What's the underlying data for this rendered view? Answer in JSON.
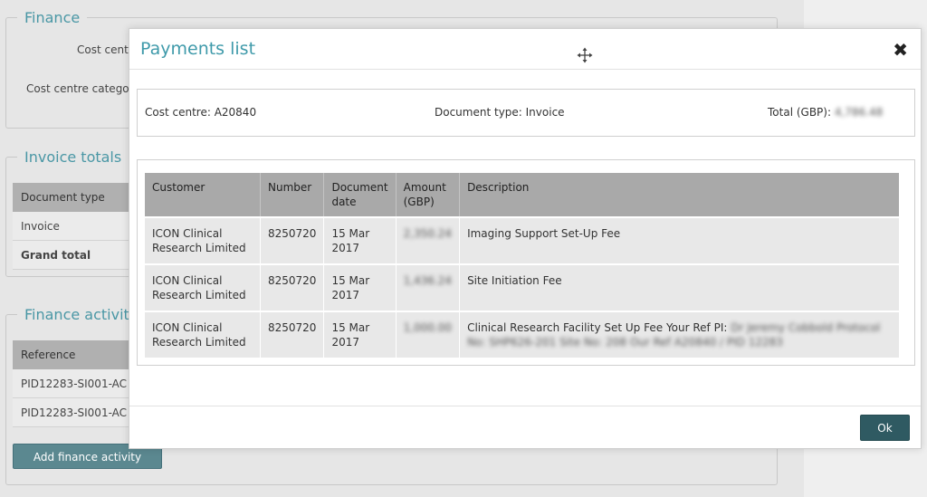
{
  "background": {
    "finance": {
      "legend": "Finance",
      "cost_centre_label": "Cost cent",
      "cost_centre_category_label": "Cost centre catego"
    },
    "invoice_totals": {
      "legend": "Invoice totals",
      "header": "Document type",
      "rows": [
        "Invoice",
        "Grand total"
      ]
    },
    "finance_activities": {
      "legend": "Finance activitie",
      "header": "Reference",
      "rows": [
        "PID12283-SI001-AC",
        "PID12283-SI001-AC"
      ],
      "add_button": "Add finance activity"
    }
  },
  "modal": {
    "title": "Payments list",
    "summary": {
      "cost_centre": "Cost centre: A20840",
      "document_type": "Document type: Invoice",
      "total_label": "Total (GBP):",
      "total_value": "4,786.48"
    },
    "table": {
      "headers": [
        "Customer",
        "Number",
        "Document date",
        "Amount (GBP)",
        "Description"
      ],
      "rows": [
        {
          "customer": "ICON Clinical Research Limited",
          "number": "8250720",
          "date": "15 Mar 2017",
          "amount": "2,350.24",
          "description": "Imaging Support Set-Up Fee",
          "description_blurred": ""
        },
        {
          "customer": "ICON Clinical Research Limited",
          "number": "8250720",
          "date": "15 Mar 2017",
          "amount": "1,436.24",
          "description": "Site Initiation Fee",
          "description_blurred": ""
        },
        {
          "customer": "ICON Clinical Research Limited",
          "number": "8250720",
          "date": "15 Mar 2017",
          "amount": "1,000.00",
          "description": "Clinical Research Facility Set Up Fee Your Ref PI:",
          "description_blurred": "Dr Jeremy Cobbold Protocol No: SHP626-201 Site No: 208 Our Ref A20840 / PID 12283"
        }
      ]
    },
    "ok_label": "Ok",
    "icons": {
      "move": "move-icon",
      "close": "close-icon"
    }
  }
}
